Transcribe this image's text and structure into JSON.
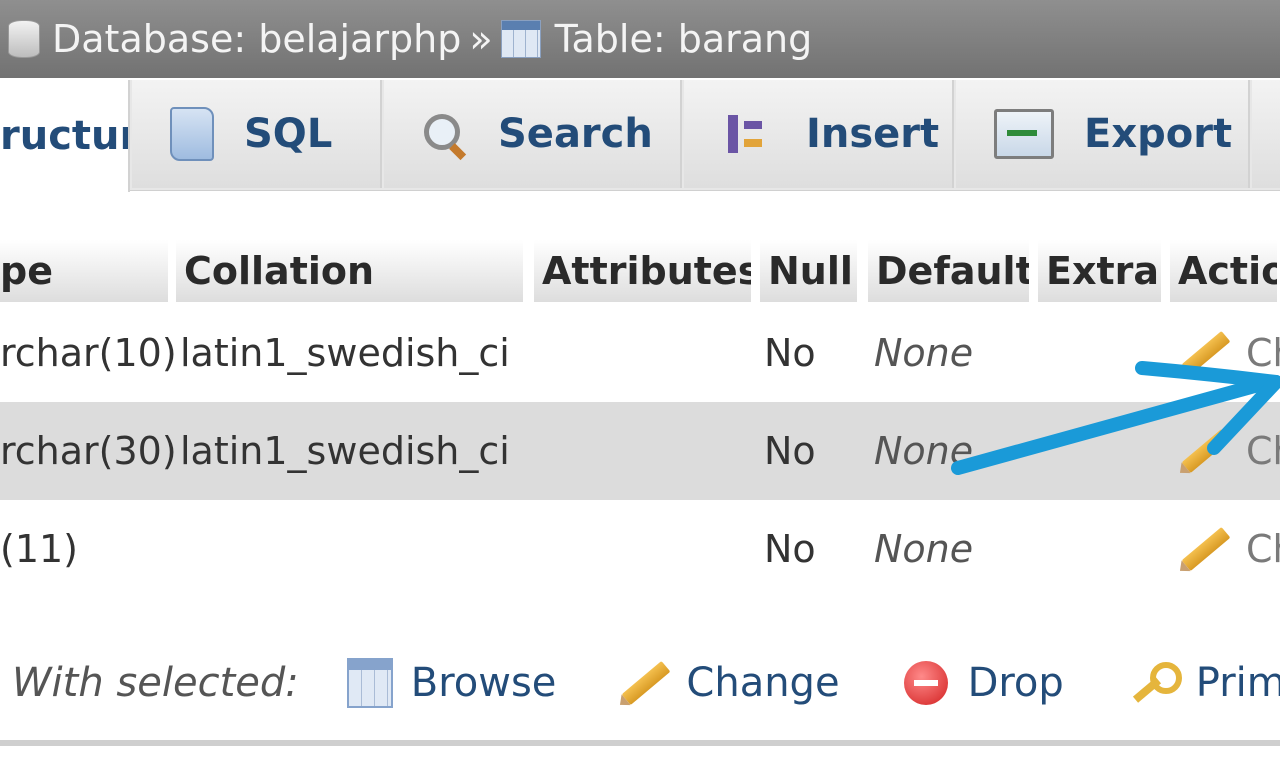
{
  "breadcrumb": {
    "database": "Database: belajarphp",
    "separator": "»",
    "table": "Table: barang"
  },
  "tabs": [
    {
      "label": "ructure",
      "active": true
    },
    {
      "label": "SQL"
    },
    {
      "label": "Search"
    },
    {
      "label": "Insert"
    },
    {
      "label": "Export"
    }
  ],
  "columns": [
    "pe",
    "Collation",
    "Attributes",
    "Null",
    "Default",
    "Extra",
    "Actio"
  ],
  "rows": [
    {
      "type": "rchar(10)",
      "collation": "latin1_swedish_ci",
      "null": "No",
      "default": "None",
      "action": "Ch"
    },
    {
      "type": "rchar(30)",
      "collation": "latin1_swedish_ci",
      "null": "No",
      "default": "None",
      "action": "Ch"
    },
    {
      "type": "(11)",
      "collation": "",
      "null": "No",
      "default": "None",
      "action": "Ch"
    }
  ],
  "with_selected": {
    "label": "With selected:",
    "browse": "Browse",
    "change": "Change",
    "drop": "Drop",
    "primary": "Prima"
  },
  "colors": {
    "header_bar": "#808080",
    "link": "#234c79",
    "annotation_arrow": "#1a9ad8"
  }
}
